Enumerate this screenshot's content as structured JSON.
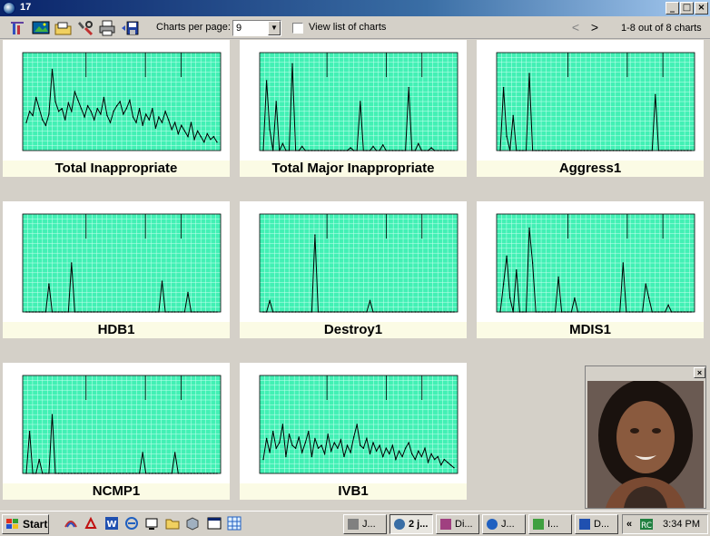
{
  "window": {
    "title": "17"
  },
  "toolbar": {
    "charts_per_page_label": "Charts per page:",
    "charts_per_page_value": "9",
    "view_list_label": "View list of charts",
    "prev": "<",
    "next": ">",
    "range_text": "1-8 out of 8 charts"
  },
  "charts": [
    {
      "caption": "Total Inappropriate"
    },
    {
      "caption": "Total Major Inappropriate"
    },
    {
      "caption": "Aggress1"
    },
    {
      "caption": "HDB1"
    },
    {
      "caption": "Destroy1"
    },
    {
      "caption": "MDIS1"
    },
    {
      "caption": "NCMP1"
    },
    {
      "caption": "IVB1"
    }
  ],
  "chart_data": [
    {
      "type": "line",
      "title": "Total Inappropriate",
      "series": [
        {
          "values": [
            20,
            28,
            25,
            38,
            30,
            22,
            18,
            26,
            58,
            35,
            28,
            30,
            22,
            34,
            28,
            42,
            36,
            30,
            24,
            32,
            28,
            22,
            30,
            26,
            38,
            25,
            20,
            28,
            32,
            35,
            26,
            30,
            36,
            24,
            20,
            30,
            18,
            26,
            22,
            30,
            16,
            24,
            20,
            28,
            22,
            15,
            20,
            12,
            18,
            14,
            10,
            20,
            8,
            14,
            10,
            6,
            12,
            8,
            10,
            6
          ]
        }
      ]
    },
    {
      "type": "line",
      "title": "Total Major Inappropriate",
      "series": [
        {
          "values": [
            0,
            50,
            15,
            0,
            35,
            0,
            5,
            0,
            0,
            62,
            0,
            0,
            3,
            0,
            0,
            0,
            0,
            0,
            0,
            0,
            0,
            0,
            0,
            0,
            0,
            0,
            0,
            2,
            0,
            0,
            35,
            0,
            0,
            0,
            3,
            0,
            0,
            4,
            0,
            0,
            0,
            0,
            0,
            0,
            0,
            45,
            0,
            0,
            5,
            0,
            0,
            0,
            2,
            0,
            0,
            0,
            0,
            0,
            0,
            0
          ]
        }
      ]
    },
    {
      "type": "line",
      "title": "Aggress1",
      "series": [
        {
          "values": [
            0,
            45,
            10,
            0,
            25,
            0,
            0,
            0,
            0,
            55,
            0,
            0,
            0,
            0,
            0,
            0,
            0,
            0,
            0,
            0,
            0,
            0,
            0,
            0,
            0,
            0,
            0,
            0,
            0,
            0,
            0,
            0,
            0,
            0,
            0,
            0,
            0,
            0,
            0,
            0,
            0,
            0,
            0,
            0,
            0,
            0,
            0,
            0,
            40,
            0,
            0,
            0,
            0,
            0,
            0,
            0,
            0,
            0,
            0,
            0
          ]
        }
      ]
    },
    {
      "type": "line",
      "title": "HDB1",
      "series": [
        {
          "values": [
            0,
            0,
            0,
            0,
            0,
            0,
            0,
            20,
            0,
            0,
            0,
            0,
            0,
            0,
            35,
            0,
            0,
            0,
            0,
            0,
            0,
            0,
            0,
            0,
            0,
            0,
            0,
            0,
            0,
            0,
            0,
            0,
            0,
            0,
            0,
            0,
            0,
            0,
            0,
            0,
            0,
            0,
            22,
            0,
            0,
            0,
            0,
            0,
            0,
            0,
            14,
            0,
            0,
            0,
            0,
            0,
            0,
            0,
            0,
            0
          ]
        }
      ]
    },
    {
      "type": "line",
      "title": "Destroy1",
      "series": [
        {
          "values": [
            0,
            0,
            8,
            0,
            0,
            0,
            0,
            0,
            0,
            0,
            0,
            0,
            0,
            0,
            0,
            0,
            55,
            0,
            0,
            0,
            0,
            0,
            0,
            0,
            0,
            0,
            0,
            0,
            0,
            0,
            0,
            0,
            0,
            8,
            0,
            0,
            0,
            0,
            0,
            0,
            0,
            0,
            0,
            0,
            0,
            0,
            0,
            0,
            0,
            0,
            0,
            0,
            0,
            0,
            0,
            0,
            0,
            0,
            0,
            0
          ]
        }
      ]
    },
    {
      "type": "line",
      "title": "MDIS1",
      "series": [
        {
          "values": [
            0,
            20,
            40,
            10,
            0,
            30,
            0,
            0,
            0,
            60,
            35,
            0,
            0,
            0,
            0,
            0,
            0,
            0,
            25,
            0,
            0,
            0,
            0,
            10,
            0,
            0,
            0,
            0,
            0,
            0,
            0,
            0,
            0,
            0,
            0,
            0,
            0,
            0,
            35,
            0,
            0,
            0,
            0,
            0,
            0,
            20,
            10,
            0,
            0,
            0,
            0,
            0,
            5,
            0,
            0,
            0,
            0,
            0,
            0,
            0
          ]
        }
      ]
    },
    {
      "type": "line",
      "title": "NCMP1",
      "series": [
        {
          "values": [
            0,
            30,
            0,
            0,
            10,
            0,
            0,
            0,
            42,
            0,
            0,
            0,
            0,
            0,
            0,
            0,
            0,
            0,
            0,
            0,
            0,
            0,
            0,
            0,
            0,
            0,
            0,
            0,
            0,
            0,
            0,
            0,
            0,
            0,
            0,
            0,
            15,
            0,
            0,
            0,
            0,
            0,
            0,
            0,
            0,
            0,
            15,
            0,
            0,
            0,
            0,
            0,
            0,
            0,
            0,
            0,
            0,
            0,
            0,
            0
          ]
        }
      ]
    },
    {
      "type": "line",
      "title": "IVB1",
      "series": [
        {
          "values": [
            10,
            25,
            15,
            30,
            18,
            22,
            35,
            12,
            28,
            20,
            18,
            26,
            15,
            22,
            30,
            12,
            25,
            18,
            20,
            14,
            28,
            16,
            22,
            18,
            24,
            12,
            20,
            15,
            26,
            35,
            20,
            18,
            25,
            14,
            22,
            16,
            20,
            12,
            18,
            14,
            20,
            10,
            16,
            12,
            18,
            22,
            14,
            10,
            16,
            12,
            18,
            8,
            14,
            10,
            12,
            6,
            10,
            8,
            6,
            4
          ]
        }
      ]
    }
  ],
  "taskbar": {
    "start": "Start",
    "tasks": [
      "J...",
      "2 j...",
      "Di...",
      "J...",
      "I...",
      "D..."
    ],
    "clock": "3:34 PM"
  }
}
